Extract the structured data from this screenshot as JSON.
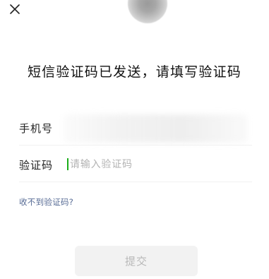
{
  "header": {
    "close_icon": "close-icon"
  },
  "title": "短信验证码已发送，请填写验证码",
  "form": {
    "phone_label": "手机号",
    "code_label": "验证码",
    "code_placeholder": "请输入验证码",
    "code_value": ""
  },
  "links": {
    "help": "收不到验证码?"
  },
  "actions": {
    "submit_label": "提交"
  },
  "colors": {
    "link": "#576b95",
    "caret": "#1aad19",
    "button_bg": "#f2f2f2",
    "button_text": "#b8b8b8"
  }
}
